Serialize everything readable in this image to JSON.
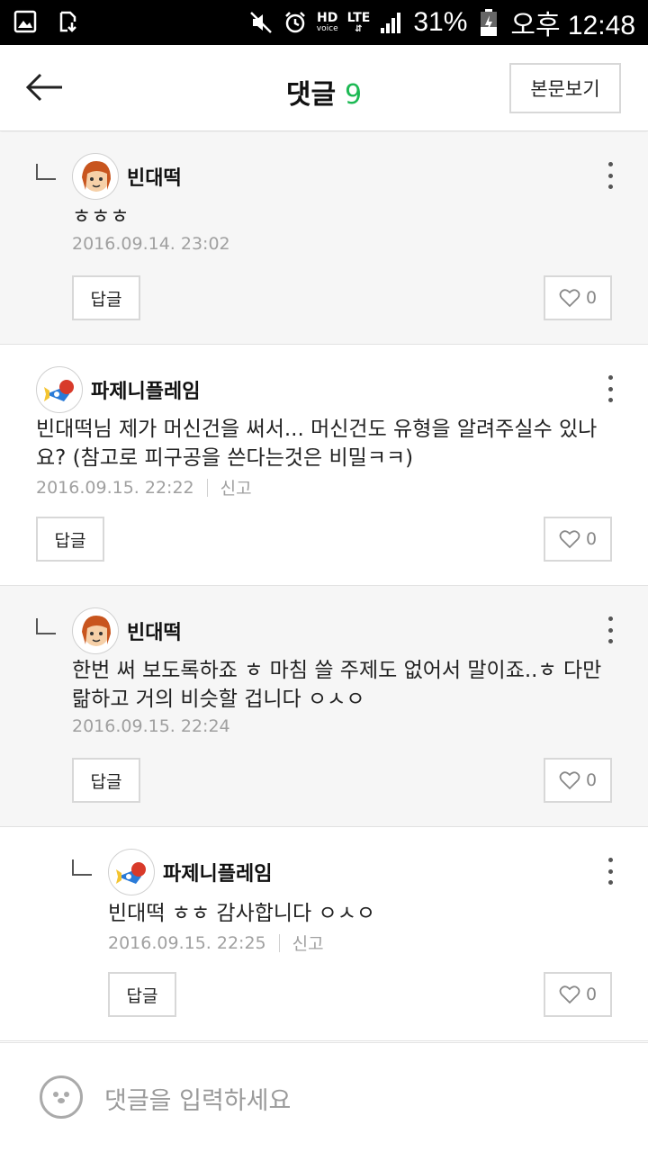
{
  "status_bar": {
    "hd_label": "HD",
    "voice_label": "voice",
    "lte_label": "LTE",
    "battery": "31%",
    "time": "오후 12:48"
  },
  "header": {
    "title": "댓글",
    "count": "9",
    "view_post_label": "본문보기",
    "back_icon": "arrow-left-icon"
  },
  "comments": [
    {
      "author": "빈대떡",
      "text": "ㅎㅎㅎ",
      "date": "2016.09.14. 23:02",
      "report": "",
      "reply_label": "답글",
      "likes": "0"
    },
    {
      "author": "파제니플레임",
      "text": "빈대떡님 제가 머신건을 써서... 머신건도 유형을 알려주실수 있나요? (참고로 피구공을 쓴다는것은 비밀ㅋㅋ)",
      "date": "2016.09.15. 22:22",
      "report": "신고",
      "reply_label": "답글",
      "likes": "0"
    },
    {
      "author": "빈대떡",
      "text": "한번 써 보도록하죠 ㅎ 마침 쓸 주제도 없어서 말이죠..ㅎ 다만 랆하고 거의 비슷할 겁니다 ㅇㅅㅇ",
      "date": "2016.09.15. 22:24",
      "report": "",
      "reply_label": "답글",
      "likes": "0"
    },
    {
      "author": "파제니플레임",
      "text": "빈대떡 ㅎㅎ 감사합니다 ㅇㅅㅇ",
      "date": "2016.09.15. 22:25",
      "report": "신고",
      "reply_label": "답글",
      "likes": "0"
    }
  ],
  "input": {
    "placeholder": "댓글을 입력하세요"
  },
  "colors": {
    "accent": "#1db954",
    "reply_bg": "#f6f6f6"
  }
}
